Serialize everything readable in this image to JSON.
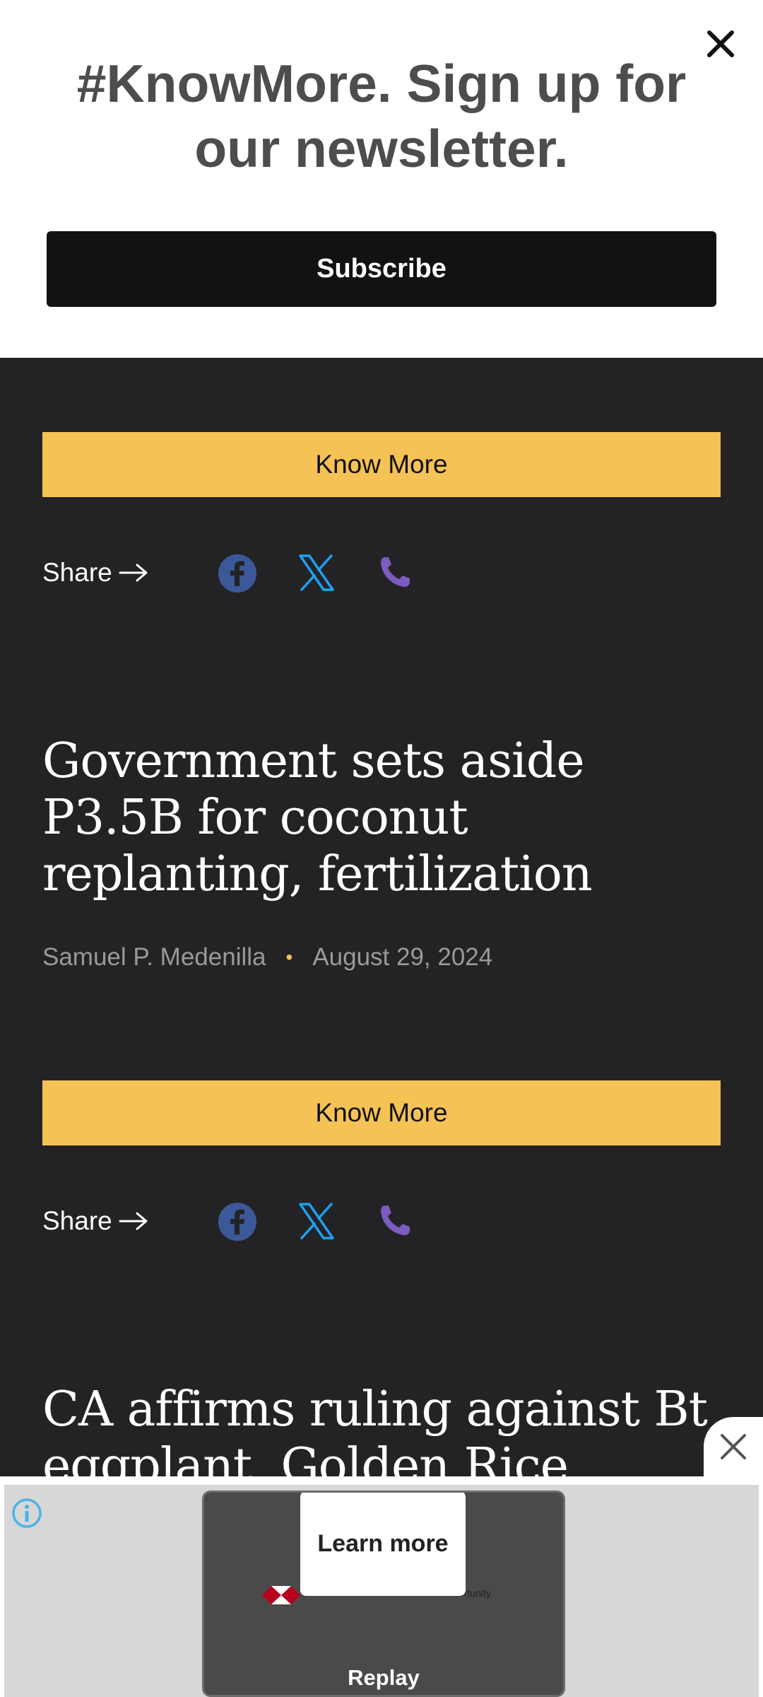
{
  "newsletter": {
    "title_line1": "#KnowMore. Sign up for",
    "title_line2": "our newsletter.",
    "subscribe_label": "Subscribe"
  },
  "feed": {
    "know_more_label": "Know More",
    "share_label": "Share",
    "articles": [
      {
        "title": "Government sets aside P3.5B for coconut replanting, fertilization",
        "author": "Samuel P. Medenilla",
        "date": "August 29, 2024"
      },
      {
        "title": "CA affirms ruling against Bt eggplant, Golden Rice"
      }
    ]
  },
  "ad": {
    "learn_more": "Learn more",
    "replay": "Replay",
    "small_text": "ortunity"
  },
  "colors": {
    "accent": "#f5c256",
    "background": "#232325",
    "facebook": "#3b5998",
    "x": "#1da1f2",
    "phone": "#7d5bbf"
  },
  "icons": [
    "close-icon",
    "arrow-right-icon",
    "facebook-icon",
    "x-icon",
    "phone-icon",
    "info-icon"
  ]
}
